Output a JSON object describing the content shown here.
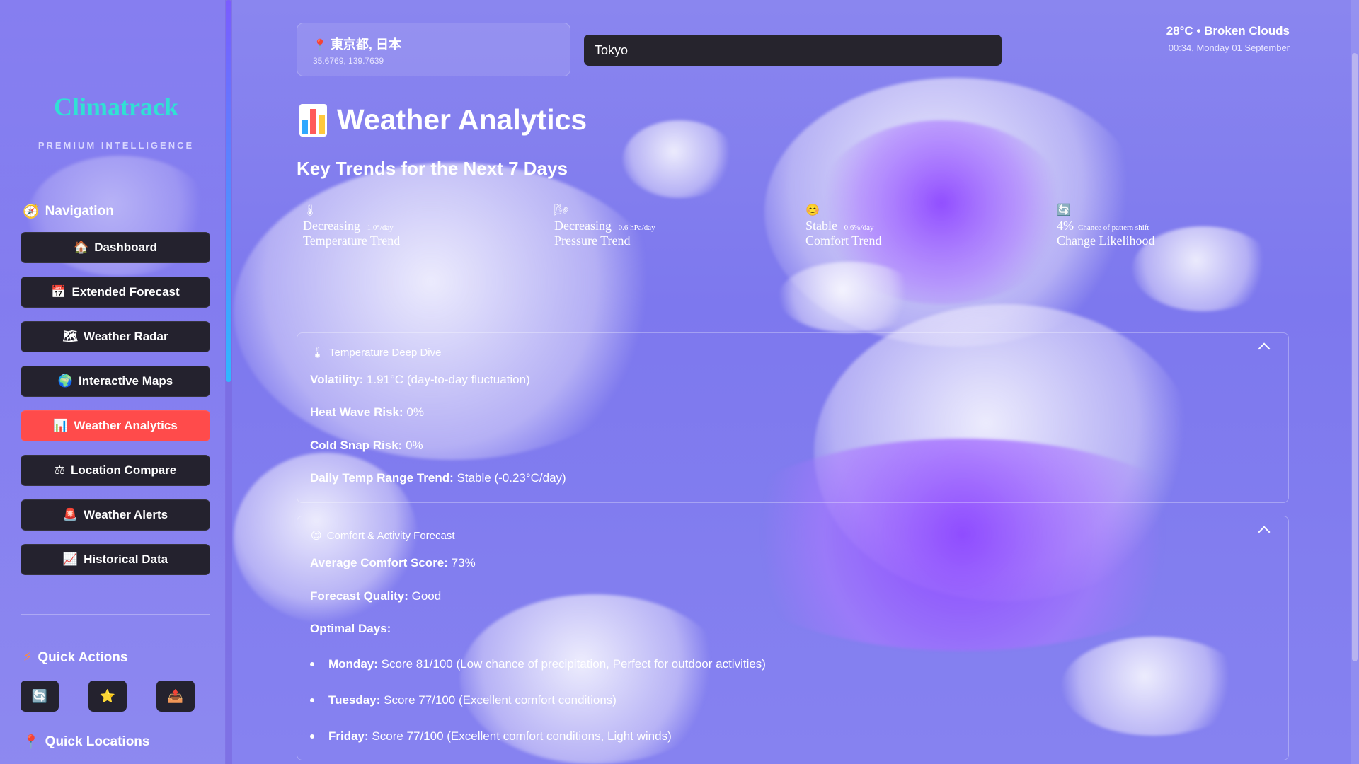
{
  "brand": {
    "name": "Climatrack",
    "tagline": "PREMIUM INTELLIGENCE"
  },
  "sidebar": {
    "nav_title": "Navigation",
    "nav_icon": "compass-icon",
    "items": [
      {
        "label": "Dashboard",
        "icon": "🏠",
        "active": false
      },
      {
        "label": "Extended Forecast",
        "icon": "📅",
        "active": false
      },
      {
        "label": "Weather Radar",
        "icon": "🗺",
        "active": false
      },
      {
        "label": "Interactive Maps",
        "icon": "🌍",
        "active": false
      },
      {
        "label": "Weather Analytics",
        "icon": "📊",
        "active": true
      },
      {
        "label": "Location Compare",
        "icon": "⚖",
        "active": false
      },
      {
        "label": "Weather Alerts",
        "icon": "🚨",
        "active": false
      },
      {
        "label": "Historical Data",
        "icon": "📈",
        "active": false
      }
    ],
    "quick_actions_title": "Quick Actions",
    "quick_actions": [
      {
        "icon": "🔄",
        "name": "refresh-icon"
      },
      {
        "icon": "⭐",
        "name": "star-icon"
      },
      {
        "icon": "📤",
        "name": "share-icon"
      }
    ],
    "quick_locations_title": "Quick Locations"
  },
  "header": {
    "location_name": "東京都, 日本",
    "coords": "35.6769, 139.7639",
    "search_value": "Tokyo",
    "current_weather": "28°C • Broken Clouds",
    "datetime": "00:34, Monday 01 September"
  },
  "page": {
    "title": "Weather Analytics",
    "subtitle": "Key Trends for the Next 7 Days"
  },
  "trends": [
    {
      "icon": "🌡",
      "value": "Decreasing",
      "detail": "-1.0°/day",
      "label": "Temperature Trend"
    },
    {
      "icon": "🌬",
      "value": "Decreasing",
      "detail": "-0.6 hPa/day",
      "label": "Pressure Trend"
    },
    {
      "icon": "😊",
      "value": "Stable",
      "detail": "-0.6%/day",
      "label": "Comfort Trend"
    },
    {
      "icon": "🔄",
      "value": "4%",
      "detail": "Chance of pattern shift",
      "label": "Change Likelihood"
    }
  ],
  "temp_panel": {
    "title": "Temperature Deep Dive",
    "rows": [
      {
        "key": "Volatility:",
        "value": "1.91°C (day-to-day fluctuation)"
      },
      {
        "key": "Heat Wave Risk:",
        "value": "0%"
      },
      {
        "key": "Cold Snap Risk:",
        "value": "0%"
      },
      {
        "key": "Daily Temp Range Trend:",
        "value": "Stable (-0.23°C/day)"
      }
    ]
  },
  "comfort_panel": {
    "title": "Comfort & Activity Forecast",
    "rows": [
      {
        "key": "Average Comfort Score:",
        "value": "73%"
      },
      {
        "key": "Forecast Quality:",
        "value": "Good"
      },
      {
        "key": "Optimal Days:",
        "value": ""
      }
    ],
    "days": [
      {
        "day": "Monday:",
        "text": "Score 81/100 (Low chance of precipitation, Perfect for outdoor activities)"
      },
      {
        "day": "Tuesday:",
        "text": "Score 77/100 (Excellent comfort conditions)"
      },
      {
        "day": "Friday:",
        "text": "Score 77/100 (Excellent comfort conditions, Light winds)"
      }
    ]
  },
  "colors": {
    "accent": "#ff4b4b",
    "brand": "#31e0d4",
    "button_bg": "#24222e"
  }
}
